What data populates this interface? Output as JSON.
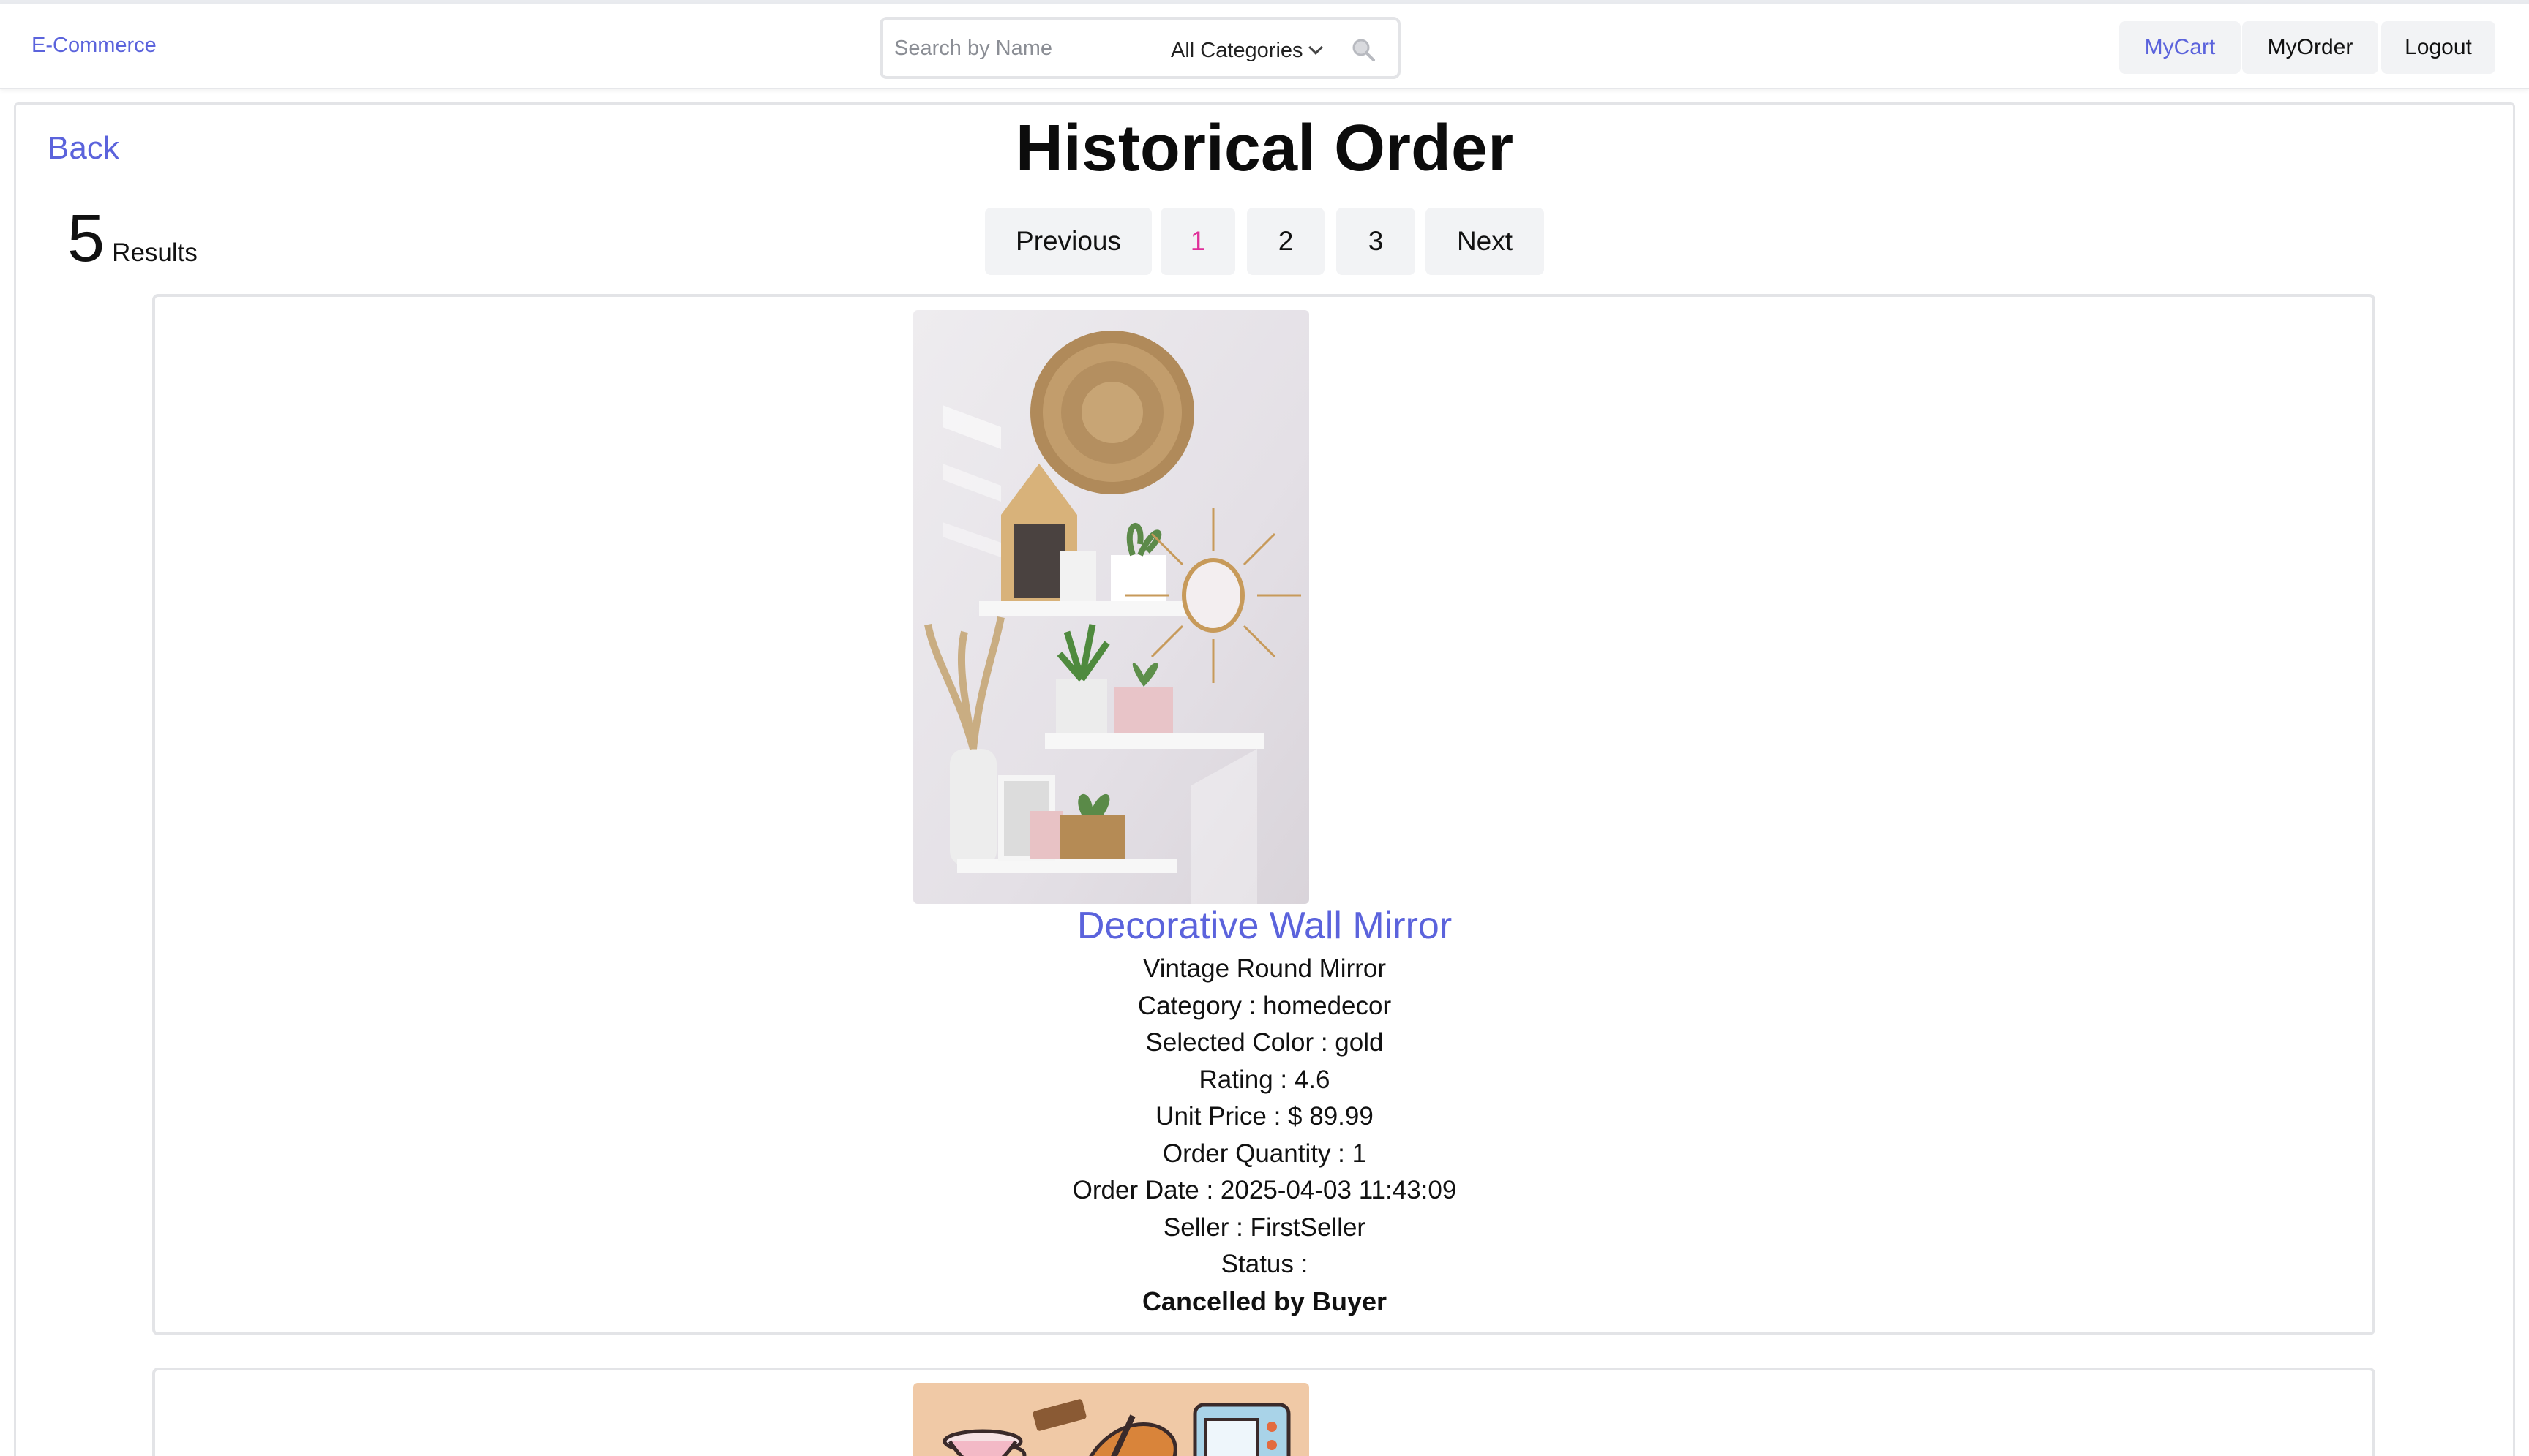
{
  "nav": {
    "brand": "E-Commerce",
    "search_placeholder": "Search by Name",
    "category_selected": "All Categories",
    "links": {
      "cart": "MyCart",
      "orders": "MyOrder",
      "logout": "Logout"
    }
  },
  "page": {
    "back": "Back",
    "title": "Historical Order",
    "results_count": "5",
    "results_label": "Results"
  },
  "pagination": {
    "previous": "Previous",
    "pages": [
      "1",
      "2",
      "3"
    ],
    "next": "Next",
    "current_page": "1"
  },
  "orders": [
    {
      "name": "Decorative Wall Mirror",
      "description": "Vintage Round Mirror",
      "category": "Category : homedecor",
      "color": "Selected Color : gold",
      "rating": "Rating : 4.6",
      "unit_price": "Unit Price : $ 89.99",
      "quantity": "Order Quantity : 1",
      "order_date": "Order Date : 2025-04-03 11:43:09",
      "seller": "Seller : FirstSeller",
      "status_label": "Status :",
      "status_value": "Cancelled by Buyer"
    }
  ],
  "colors": {
    "accent": "#5b63dc",
    "current_page": "#e0309a",
    "button_bg": "#f2f3f5",
    "border": "#e3e4e7"
  }
}
